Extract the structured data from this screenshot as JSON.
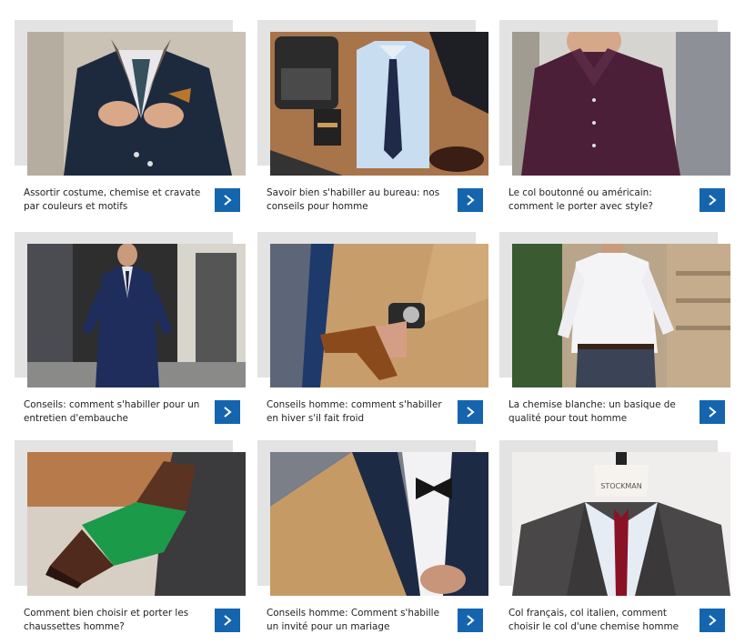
{
  "articles": [
    {
      "title": "Assortir costume, chemise et cravate par couleurs et motifs",
      "photo_icon": "suit-tie-icon",
      "button_icon": "chevron-right-icon"
    },
    {
      "title": "Savoir bien s'habiller au bureau: nos conseils pour homme",
      "photo_icon": "shirt-typewriter-icon",
      "button_icon": "chevron-right-icon"
    },
    {
      "title": "Le col boutonné ou américain: comment le porter avec style?",
      "photo_icon": "button-down-shirt-icon",
      "button_icon": "chevron-right-icon"
    },
    {
      "title": "Conseils: comment s'habiller pour un entretien d'embauche",
      "photo_icon": "navy-suit-man-icon",
      "button_icon": "chevron-right-icon"
    },
    {
      "title": "Conseils homme: comment s'habiller en hiver s'il fait froid",
      "photo_icon": "camel-coat-gloves-icon",
      "button_icon": "chevron-right-icon"
    },
    {
      "title": "La chemise blanche: un basique de qualité pour tout homme",
      "photo_icon": "white-shirt-man-icon",
      "button_icon": "chevron-right-icon"
    },
    {
      "title": "Comment bien choisir et porter les chaussettes homme?",
      "photo_icon": "green-socks-shoe-icon",
      "button_icon": "chevron-right-icon"
    },
    {
      "title": "Conseils homme: Comment s'habille un invité pour un mariage",
      "photo_icon": "bowtie-jacket-icon",
      "button_icon": "chevron-right-icon"
    },
    {
      "title": "Col français, col italien, comment choisir le col d'une chemise homme",
      "photo_icon": "mannequin-collar-icon",
      "button_icon": "chevron-right-icon"
    }
  ],
  "mannequin_label": "STOCKMAN",
  "colors": {
    "button": "#1565ae",
    "frame": "#e3e3e3",
    "text": "#222222"
  }
}
